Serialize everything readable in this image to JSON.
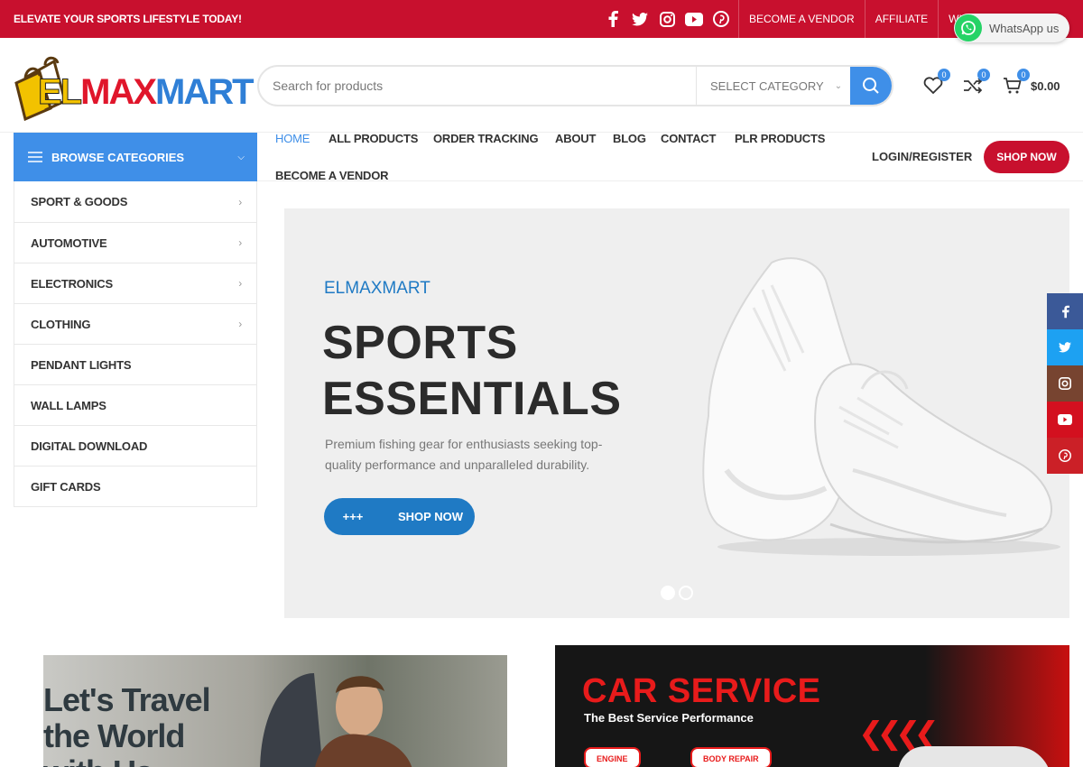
{
  "topbar": {
    "promo": "ELEVATE YOUR SPORTS LIFESTYLE TODAY!",
    "social_icons": [
      "facebook-icon",
      "twitter-icon",
      "instagram-icon",
      "youtube-icon",
      "pinterest-icon"
    ],
    "links": [
      "BECOME A VENDOR",
      "AFFILIATE",
      "WI"
    ],
    "whatsapp_label": "WhatsApp us"
  },
  "header": {
    "logo": {
      "part1": "EL",
      "part2": "MAX",
      "part3": "MART"
    },
    "search": {
      "placeholder": "Search for products",
      "category": "SELECT CATEGORY"
    },
    "wishlist_count": "0",
    "compare_count": "0",
    "cart_count": "0",
    "cart_total": "$0.00"
  },
  "nav": {
    "browse_label": "BROWSE CATEGORIES",
    "items": [
      "HOME",
      "ALL PRODUCTS",
      "ORDER TRACKING",
      "ABOUT",
      "BLOG",
      "CONTACT",
      "PLR PRODUCTS",
      "BECOME A VENDOR"
    ],
    "login": "LOGIN/REGISTER",
    "shop_now": "SHOP NOW"
  },
  "categories": [
    {
      "label": "SPORT & GOODS",
      "has_submenu": true
    },
    {
      "label": "AUTOMOTIVE",
      "has_submenu": true
    },
    {
      "label": "ELECTRONICS",
      "has_submenu": true
    },
    {
      "label": "CLOTHING",
      "has_submenu": true
    },
    {
      "label": "PENDANT LIGHTS",
      "has_submenu": false
    },
    {
      "label": "WALL LAMPS",
      "has_submenu": false
    },
    {
      "label": "DIGITAL DOWNLOAD",
      "has_submenu": false
    },
    {
      "label": "GIFT CARDS",
      "has_submenu": false
    }
  ],
  "hero": {
    "eyebrow": "ELMAXMART",
    "title_line1": "SPORTS",
    "title_line2": "ESSENTIALS",
    "description": "Premium fishing gear for enthusiasts seeking top-quality performance and unparalleled durability.",
    "cta_prefix": "+++",
    "cta_label": "SHOP NOW",
    "slides": 2,
    "active_slide": 1
  },
  "share_bar": [
    "facebook-icon",
    "twitter-icon",
    "instagram-icon",
    "youtube-icon",
    "pinterest-icon"
  ],
  "promos": {
    "travel": {
      "line1": "Let's Travel",
      "line2": "the World",
      "line3": "with Us"
    },
    "car": {
      "title": "CAR SERVICE",
      "subtitle": "The Best Service Performance",
      "tag1": "ENGINE",
      "tag2": "BODY REPAIR"
    }
  },
  "colors": {
    "brand_red": "#c8102e",
    "accent_blue": "#3f8fe8",
    "hero_blue": "#1f7ac4"
  }
}
